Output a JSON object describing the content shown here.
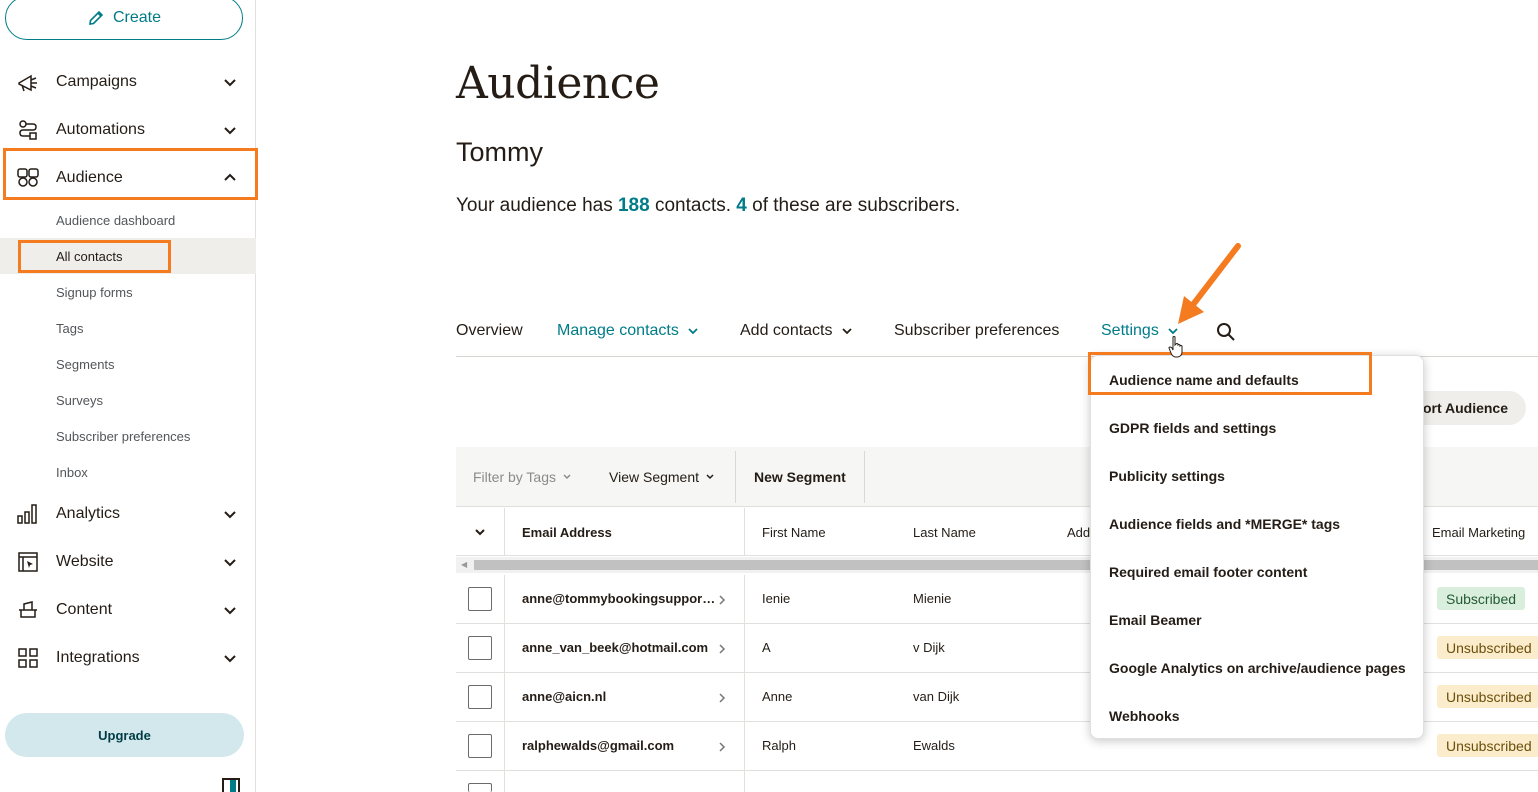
{
  "sidebar": {
    "create_label": "Create",
    "items": [
      {
        "label": "Campaigns",
        "icon": "megaphone-icon"
      },
      {
        "label": "Automations",
        "icon": "automations-icon"
      },
      {
        "label": "Audience",
        "icon": "audience-icon"
      },
      {
        "label": "Analytics",
        "icon": "bar-chart-icon"
      },
      {
        "label": "Website",
        "icon": "website-icon"
      },
      {
        "label": "Content",
        "icon": "content-icon"
      },
      {
        "label": "Integrations",
        "icon": "grid-icon"
      }
    ],
    "audience_sub": [
      "Audience dashboard",
      "All contacts",
      "Signup forms",
      "Tags",
      "Segments",
      "Surveys",
      "Subscriber preferences",
      "Inbox"
    ],
    "upgrade_label": "Upgrade"
  },
  "header": {
    "title": "Audience",
    "audience_name": "Tommy",
    "summary_prefix": "Your audience has ",
    "contacts_count": "188",
    "summary_mid": " contacts. ",
    "subscribers_count": "4",
    "summary_suffix": " of these are subscribers."
  },
  "tabs": {
    "overview": "Overview",
    "manage_contacts": "Manage contacts",
    "add_contacts": "Add contacts",
    "subscriber_preferences": "Subscriber preferences",
    "settings": "Settings"
  },
  "export_label": "ort Audience",
  "filter_bar": {
    "filter_tags": "Filter by Tags",
    "view_segment": "View Segment",
    "new_segment": "New Segment"
  },
  "table": {
    "columns": [
      "Email Address",
      "First Name",
      "Last Name",
      "Add",
      "Email Marketing"
    ],
    "rows": [
      {
        "email": "anne@tommybookingsupport.com",
        "first": "Ienie",
        "last": "Mienie",
        "status": "Subscribed"
      },
      {
        "email": "anne_van_beek@hotmail.com",
        "first": "A",
        "last": "v Dijk",
        "status": "Unsubscribed"
      },
      {
        "email": "anne@aicn.nl",
        "first": "Anne",
        "last": "van Dijk",
        "status": "Unsubscribed"
      },
      {
        "email": "ralphewalds@gmail.com",
        "first": "Ralph",
        "last": "Ewalds",
        "status": "Unsubscribed"
      }
    ]
  },
  "settings_menu": [
    "Audience name and defaults",
    "GDPR fields and settings",
    "Publicity settings",
    "Audience fields and *MERGE* tags",
    "Required email footer content",
    "Email Beamer",
    "Google Analytics on archive/audience pages",
    "Webhooks"
  ],
  "colors": {
    "accent": "#007c89",
    "highlight": "#f47b20",
    "subscribed_bg": "#daeedd",
    "unsubscribed_bg": "#fbeccb"
  }
}
